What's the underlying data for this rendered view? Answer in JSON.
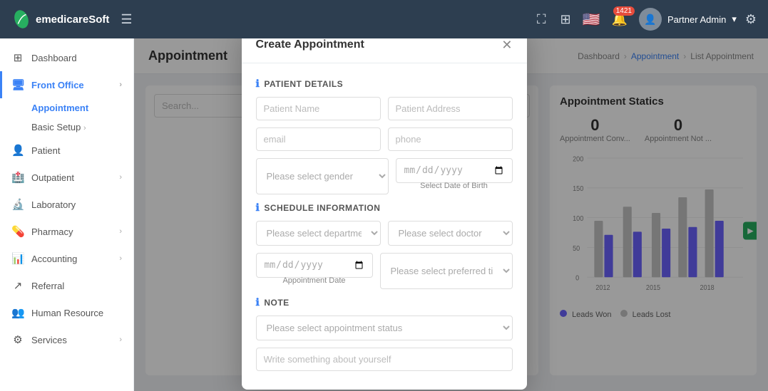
{
  "topnav": {
    "logo_text": "emedicareSoft",
    "notification_count": "1421",
    "user_label": "Partner Admin",
    "dropdown_arrow": "▾"
  },
  "sidebar": {
    "items": [
      {
        "id": "dashboard",
        "label": "Dashboard",
        "icon": "⊞",
        "active": false,
        "has_sub": false
      },
      {
        "id": "front-office",
        "label": "Front Office",
        "icon": "🖥",
        "active": true,
        "has_sub": true
      },
      {
        "id": "appointment",
        "label": "Appointment",
        "sub": true,
        "active": true
      },
      {
        "id": "basic-setup",
        "label": "Basic Setup",
        "sub": true,
        "active": false,
        "has_chevron": true
      },
      {
        "id": "patient",
        "label": "Patient",
        "icon": "👤",
        "active": false,
        "has_sub": false
      },
      {
        "id": "outpatient",
        "label": "Outpatient",
        "icon": "🏥",
        "active": false,
        "has_sub": true
      },
      {
        "id": "laboratory",
        "label": "Laboratory",
        "icon": "🔬",
        "active": false,
        "has_sub": false
      },
      {
        "id": "pharmacy",
        "label": "Pharmacy",
        "icon": "💊",
        "active": false,
        "has_sub": true
      },
      {
        "id": "accounting",
        "label": "Accounting",
        "icon": "📊",
        "active": false,
        "has_sub": true
      },
      {
        "id": "referral",
        "label": "Referral",
        "icon": "↗",
        "active": false,
        "has_sub": false
      },
      {
        "id": "human-resource",
        "label": "Human Resource",
        "icon": "👥",
        "active": false,
        "has_sub": false
      },
      {
        "id": "services",
        "label": "Services",
        "icon": "⚙",
        "active": false,
        "has_sub": true
      }
    ]
  },
  "page": {
    "title": "Appointment",
    "breadcrumb": [
      "Dashboard",
      "Appointment",
      "List Appointment"
    ]
  },
  "search": {
    "placeholder": "Search..."
  },
  "stats": {
    "title": "Appointment Statics",
    "conv_label": "Appointment Conv...",
    "not_label": "Appointment Not ...",
    "conv_value": "0",
    "not_value": "0",
    "y_labels": [
      "200",
      "150",
      "100",
      "50",
      "0"
    ],
    "x_labels": [
      "2012",
      "2015",
      "2018"
    ],
    "legend": [
      {
        "label": "Leads Won",
        "color": "#6c63ff"
      },
      {
        "label": "Leads Lost",
        "color": "#c5c5c5"
      }
    ]
  },
  "modal": {
    "title": "Create Appointment",
    "close_icon": "✕",
    "section1": "PATIENT DETAILS",
    "section2": "SCHEDULE INFORMATION",
    "section3": "NOTE",
    "fields": {
      "patient_name_placeholder": "Patient Name",
      "patient_address_placeholder": "Patient Address",
      "email_placeholder": "email",
      "phone_placeholder": "phone",
      "gender_placeholder": "Please select gender",
      "dob_placeholder": "yyyy/mm/dd",
      "dob_hint": "Select Date of Birth",
      "department_placeholder": "Please select department",
      "doctor_placeholder": "Please select doctor",
      "appt_date_placeholder": "yyyy/mm/dd",
      "appt_date_hint": "Appointment Date",
      "preferred_time_placeholder": "Please select preferred time",
      "appt_status_placeholder": "Please select appointment status",
      "note_placeholder": "Write something about yourself"
    }
  }
}
